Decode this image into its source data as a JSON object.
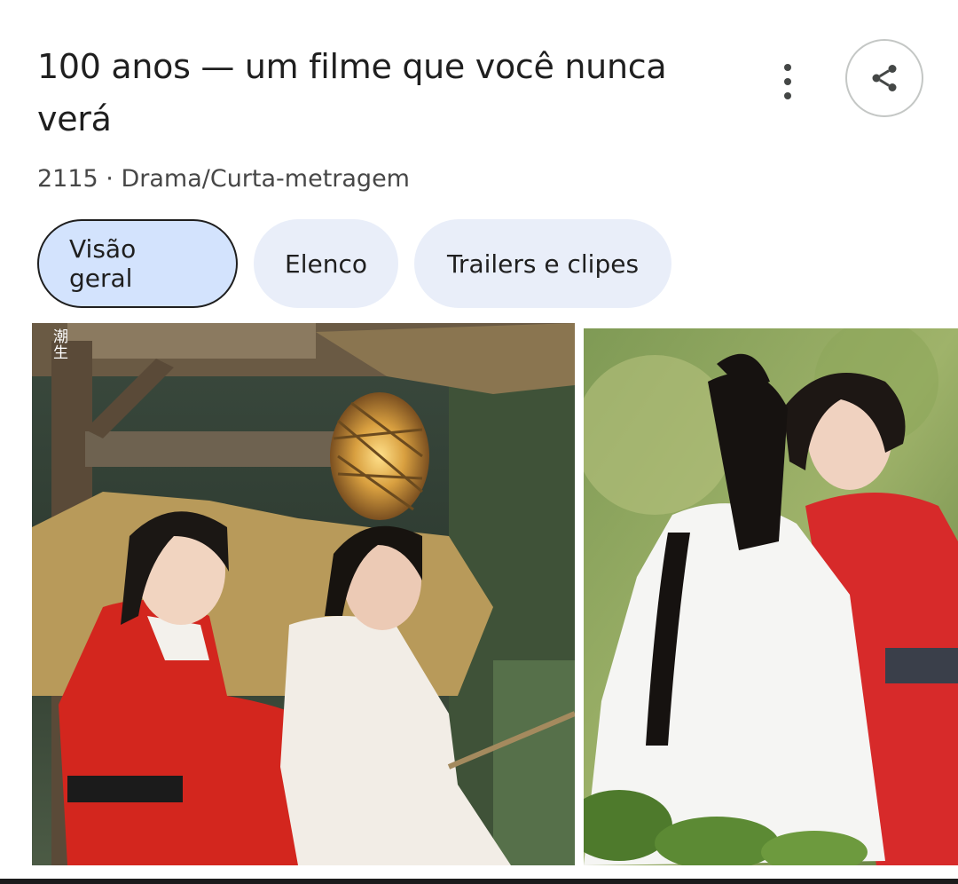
{
  "header": {
    "title": "100 anos — um filme que você nunca verá",
    "subtitle": "2115 · Drama/Curta-metragem"
  },
  "actions": {
    "more_icon": "more-vert-icon",
    "share_icon": "share-icon"
  },
  "tabs": [
    {
      "label": "Visão geral",
      "active": true
    },
    {
      "label": "Elenco",
      "active": false
    },
    {
      "label": "Trailers e clipes",
      "active": false
    }
  ],
  "images": {
    "left_watermark": "潮生"
  },
  "colors": {
    "active_tab_bg": "#d3e3fd",
    "tab_bg": "#e9eef9",
    "title_text": "#1f1f1f"
  }
}
